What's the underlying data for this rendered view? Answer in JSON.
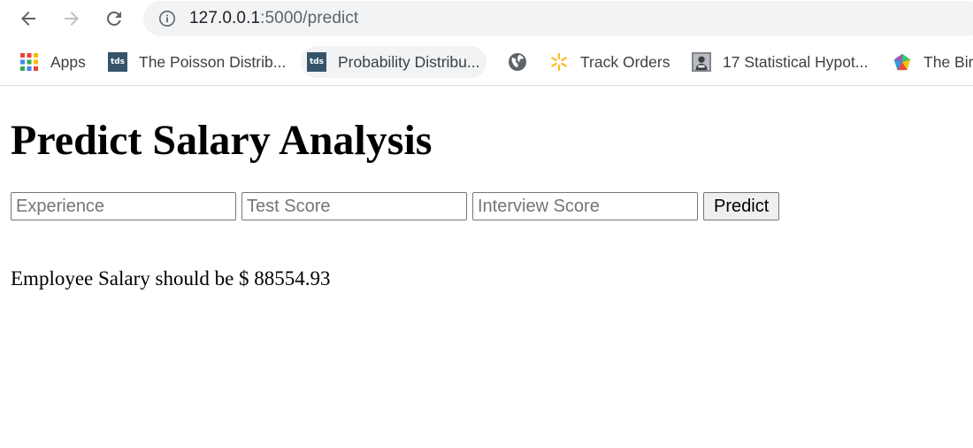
{
  "browser": {
    "url_host": "127.0.0.1",
    "url_rest": ":5000/predict",
    "bookmarks": [
      {
        "label": "Apps",
        "icon": "apps-grid-icon"
      },
      {
        "label": "The Poisson Distrib...",
        "icon": "tds-icon"
      },
      {
        "label": "Probability Distribu...",
        "icon": "tds-icon"
      },
      {
        "label": "",
        "icon": "globe-icon"
      },
      {
        "label": "Track Orders",
        "icon": "walmart-spark-icon"
      },
      {
        "label": "17 Statistical Hypot...",
        "icon": "person-thumbnail-icon"
      },
      {
        "label": "The Bir",
        "icon": "crystal-icon"
      }
    ],
    "tds_text": "tds"
  },
  "page": {
    "title": "Predict Salary Analysis",
    "form": {
      "experience_placeholder": "Experience",
      "test_score_placeholder": "Test Score",
      "interview_score_placeholder": "Interview Score",
      "predict_label": "Predict"
    },
    "result_text": "Employee Salary should be $ 88554.93"
  },
  "colors": {
    "omnibox_bg": "#f1f3f4",
    "tds_brand": "#355469"
  }
}
